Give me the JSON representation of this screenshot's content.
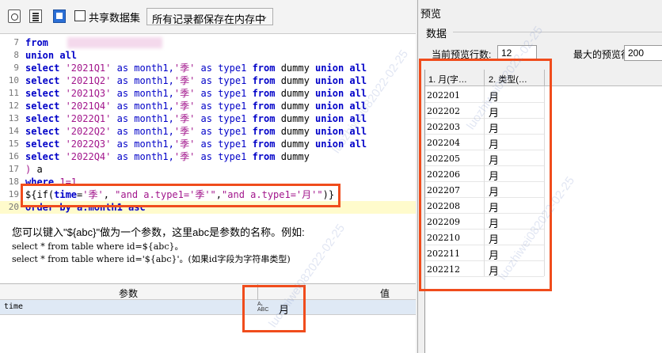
{
  "toolbar": {
    "share_label": "共享数据集",
    "mode_value": "所有记录都保存在内存中"
  },
  "code_lines": [
    {
      "n": "7",
      "parts": [
        {
          "t": "from",
          "k": "kw"
        }
      ]
    },
    {
      "n": "8",
      "parts": [
        {
          "t": "union all",
          "k": "kw"
        }
      ]
    },
    {
      "n": "9",
      "parts": [
        {
          "t": "select ",
          "k": "kw"
        },
        {
          "t": "'2021Q1'",
          "k": "str"
        },
        {
          "t": " as month1,",
          "k": "kwm"
        },
        {
          "t": "'季'",
          "k": "str"
        },
        {
          "t": " as type1 ",
          "k": "kwm"
        },
        {
          "t": "from",
          "k": "kw"
        },
        {
          "t": " dummy ",
          "k": "plain"
        },
        {
          "t": "union all",
          "k": "kw"
        }
      ]
    },
    {
      "n": "10",
      "parts": [
        {
          "t": "select ",
          "k": "kw"
        },
        {
          "t": "'2021Q2'",
          "k": "str"
        },
        {
          "t": " as month1,",
          "k": "kwm"
        },
        {
          "t": "'季'",
          "k": "str"
        },
        {
          "t": " as type1 ",
          "k": "kwm"
        },
        {
          "t": "from",
          "k": "kw"
        },
        {
          "t": " dummy ",
          "k": "plain"
        },
        {
          "t": "union all",
          "k": "kw"
        }
      ]
    },
    {
      "n": "11",
      "parts": [
        {
          "t": "select ",
          "k": "kw"
        },
        {
          "t": "'2021Q3'",
          "k": "str"
        },
        {
          "t": " as month1,",
          "k": "kwm"
        },
        {
          "t": "'季'",
          "k": "str"
        },
        {
          "t": " as type1 ",
          "k": "kwm"
        },
        {
          "t": "from",
          "k": "kw"
        },
        {
          "t": " dummy ",
          "k": "plain"
        },
        {
          "t": "union all",
          "k": "kw"
        }
      ]
    },
    {
      "n": "12",
      "parts": [
        {
          "t": "select ",
          "k": "kw"
        },
        {
          "t": "'2021Q4'",
          "k": "str"
        },
        {
          "t": " as month1,",
          "k": "kwm"
        },
        {
          "t": "'季'",
          "k": "str"
        },
        {
          "t": " as type1 ",
          "k": "kwm"
        },
        {
          "t": "from",
          "k": "kw"
        },
        {
          "t": " dummy ",
          "k": "plain"
        },
        {
          "t": "union all",
          "k": "kw"
        }
      ]
    },
    {
      "n": "13",
      "parts": [
        {
          "t": "select ",
          "k": "kw"
        },
        {
          "t": "'2022Q1'",
          "k": "str"
        },
        {
          "t": " as month1,",
          "k": "kwm"
        },
        {
          "t": "'季'",
          "k": "str"
        },
        {
          "t": " as type1 ",
          "k": "kwm"
        },
        {
          "t": "from",
          "k": "kw"
        },
        {
          "t": " dummy ",
          "k": "plain"
        },
        {
          "t": "union all",
          "k": "kw"
        }
      ]
    },
    {
      "n": "14",
      "parts": [
        {
          "t": "select ",
          "k": "kw"
        },
        {
          "t": "'2022Q2'",
          "k": "str"
        },
        {
          "t": " as month1,",
          "k": "kwm"
        },
        {
          "t": "'季'",
          "k": "str"
        },
        {
          "t": " as type1 ",
          "k": "kwm"
        },
        {
          "t": "from",
          "k": "kw"
        },
        {
          "t": " dummy ",
          "k": "plain"
        },
        {
          "t": "union all",
          "k": "kw"
        }
      ]
    },
    {
      "n": "15",
      "parts": [
        {
          "t": "select ",
          "k": "kw"
        },
        {
          "t": "'2022Q3'",
          "k": "str"
        },
        {
          "t": " as month1,",
          "k": "kwm"
        },
        {
          "t": "'季'",
          "k": "str"
        },
        {
          "t": " as type1 ",
          "k": "kwm"
        },
        {
          "t": "from",
          "k": "kw"
        },
        {
          "t": " dummy ",
          "k": "plain"
        },
        {
          "t": "union all",
          "k": "kw"
        }
      ]
    },
    {
      "n": "16",
      "parts": [
        {
          "t": "select ",
          "k": "kw"
        },
        {
          "t": "'2022Q4'",
          "k": "str"
        },
        {
          "t": " as month1,",
          "k": "kwm"
        },
        {
          "t": "'季'",
          "k": "str"
        },
        {
          "t": " as type1 ",
          "k": "kwm"
        },
        {
          "t": "from",
          "k": "kw"
        },
        {
          "t": " dummy",
          "k": "plain"
        }
      ]
    },
    {
      "n": "17",
      "parts": [
        {
          "t": ") ",
          "k": "str"
        },
        {
          "t": "a",
          "k": "plain"
        }
      ]
    },
    {
      "n": "18",
      "parts": [
        {
          "t": "where ",
          "k": "kw"
        },
        {
          "t": "1=1",
          "k": "str"
        }
      ]
    },
    {
      "n": "19",
      "parts": [
        {
          "t": "${if(",
          "k": "plain"
        },
        {
          "t": "time",
          "k": "kw"
        },
        {
          "t": "=",
          "k": "plain"
        },
        {
          "t": "'季'",
          "k": "str"
        },
        {
          "t": ", ",
          "k": "plain"
        },
        {
          "t": "\"and a.type1='季'\"",
          "k": "str"
        },
        {
          "t": ",",
          "k": "plain"
        },
        {
          "t": "\"and a.type1='月'\"",
          "k": "str"
        },
        {
          "t": ")}",
          "k": "plain"
        }
      ]
    },
    {
      "n": "20",
      "parts": [
        {
          "t": "order by a.month1 asc",
          "k": "kw"
        }
      ]
    }
  ],
  "hint": {
    "line1": "您可以键入\"${abc}\"做为一个参数，这里abc是参数的名称。例如:",
    "line2": "select * from table where id=${abc}。",
    "line3": "select * from table where id='${abc}'。(如果id字段为字符串类型)"
  },
  "params": {
    "col_name": "参数",
    "col_value": "值",
    "rows": [
      {
        "name": "time",
        "value": "月",
        "icon_text": "ABC"
      }
    ]
  },
  "preview": {
    "title": "预览",
    "group": "数据",
    "current_label": "当前预览行数:",
    "current_value": "12",
    "max_label": "最大的预览行数:",
    "max_value": "200",
    "columns": [
      "1. 月(字…",
      "2. 类型(…"
    ],
    "rows": [
      [
        "202201",
        "月"
      ],
      [
        "202202",
        "月"
      ],
      [
        "202203",
        "月"
      ],
      [
        "202204",
        "月"
      ],
      [
        "202205",
        "月"
      ],
      [
        "202206",
        "月"
      ],
      [
        "202207",
        "月"
      ],
      [
        "202208",
        "月"
      ],
      [
        "202209",
        "月"
      ],
      [
        "202210",
        "月"
      ],
      [
        "202211",
        "月"
      ],
      [
        "202212",
        "月"
      ]
    ]
  },
  "watermark_text": "luozhiwei082022-02-25",
  "colors": {
    "keyword": "#0000c8",
    "string": "#a2168c",
    "annotation": "#f04c1c"
  },
  "icons": [
    "preview-icon",
    "list-icon",
    "dataset-icon",
    "checkbox",
    "chevron-down-icon",
    "text-type-icon"
  ]
}
